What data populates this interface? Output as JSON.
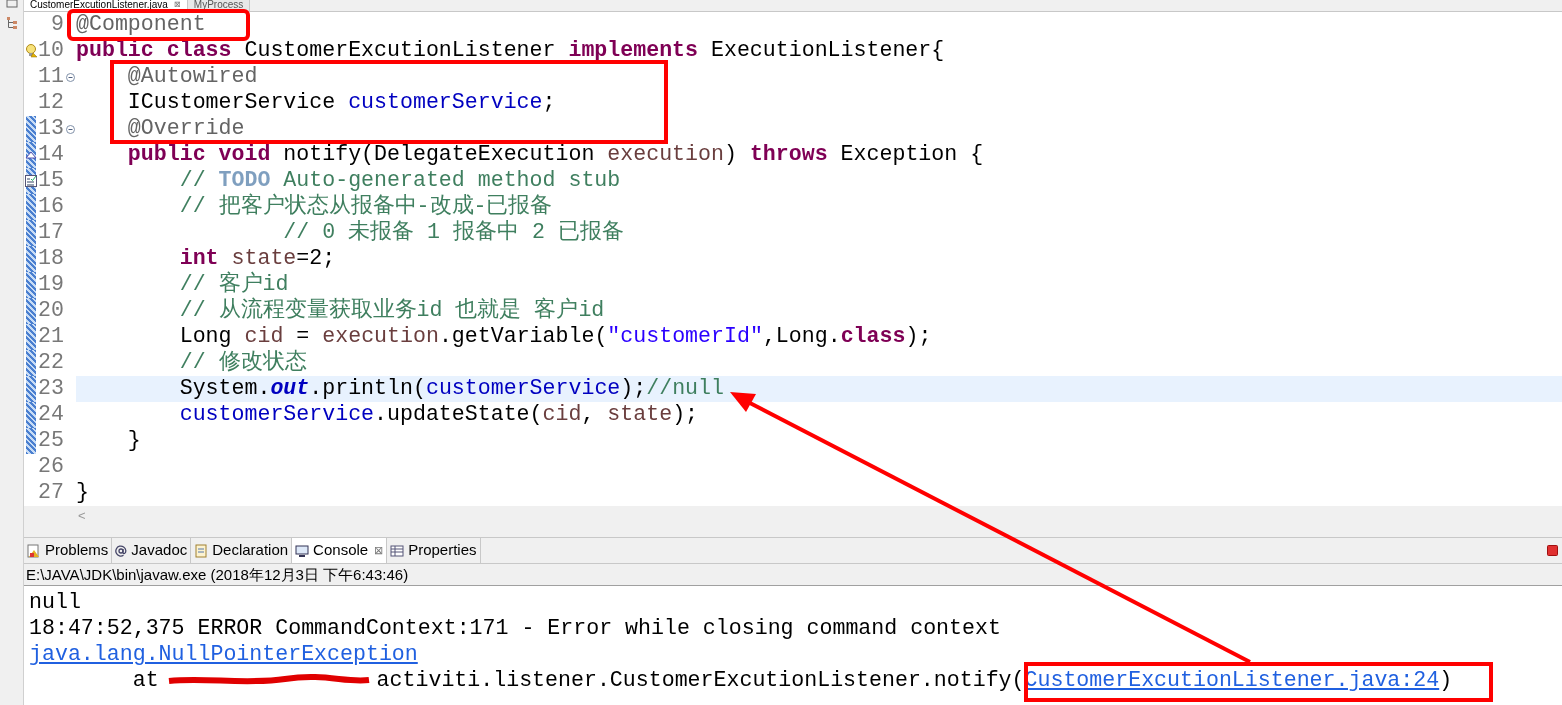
{
  "editor_tabs": [
    {
      "label": "CustomerExcutionListener.java",
      "selected": true,
      "close": "⊠"
    },
    {
      "label": "MyProcess",
      "selected": false
    }
  ],
  "code_lines": [
    {
      "number": "9",
      "kind": "none",
      "fold": false,
      "marked": false,
      "highlighted": false,
      "tokens": [
        {
          "text": "@Component",
          "kind": "annotation"
        }
      ]
    },
    {
      "number": "10",
      "kind": "warning",
      "fold": false,
      "marked": false,
      "highlighted": false,
      "tokens": [
        {
          "text": "public class ",
          "kind": "keyword"
        },
        {
          "text": "CustomerExcutionListener ",
          "kind": "plain"
        },
        {
          "text": "implements ",
          "kind": "keyword"
        },
        {
          "text": "ExecutionListener{",
          "kind": "plain"
        }
      ]
    },
    {
      "number": "11",
      "kind": "none",
      "fold": true,
      "marked": false,
      "highlighted": false,
      "tokens": [
        {
          "text": "    @Autowired",
          "kind": "annotation"
        }
      ]
    },
    {
      "number": "12",
      "kind": "none",
      "fold": false,
      "marked": false,
      "highlighted": false,
      "tokens": [
        {
          "text": "    ICustomerService ",
          "kind": "plain"
        },
        {
          "text": "customerService",
          "kind": "field"
        },
        {
          "text": ";",
          "kind": "plain"
        }
      ]
    },
    {
      "number": "13",
      "kind": "none",
      "fold": true,
      "marked": true,
      "highlighted": false,
      "tokens": [
        {
          "text": "    @Override",
          "kind": "annotation"
        }
      ]
    },
    {
      "number": "14",
      "kind": "override",
      "fold": false,
      "marked": true,
      "highlighted": false,
      "tokens": [
        {
          "text": "    public void ",
          "kind": "keyword"
        },
        {
          "text": "notify(DelegateExecution ",
          "kind": "plain"
        },
        {
          "text": "execution",
          "kind": "local"
        },
        {
          "text": ") ",
          "kind": "plain"
        },
        {
          "text": "throws ",
          "kind": "keyword"
        },
        {
          "text": "Exception {",
          "kind": "plain"
        }
      ]
    },
    {
      "number": "15",
      "kind": "task",
      "fold": false,
      "marked": true,
      "highlighted": false,
      "tokens": [
        {
          "text": "        // ",
          "kind": "comment"
        },
        {
          "text": "TODO ",
          "kind": "todo"
        },
        {
          "text": "Auto-generated method stub",
          "kind": "comment"
        }
      ]
    },
    {
      "number": "16",
      "kind": "none",
      "fold": false,
      "marked": true,
      "highlighted": false,
      "tokens": [
        {
          "text": "        // 把客户状态从报备中-改成-已报备",
          "kind": "comment"
        }
      ]
    },
    {
      "number": "17",
      "kind": "none",
      "fold": false,
      "marked": true,
      "highlighted": false,
      "tokens": [
        {
          "text": "                // 0 未报备 1 报备中 2 已报备",
          "kind": "comment"
        }
      ]
    },
    {
      "number": "18",
      "kind": "none",
      "fold": false,
      "marked": true,
      "highlighted": false,
      "tokens": [
        {
          "text": "        int ",
          "kind": "keyword"
        },
        {
          "text": "state",
          "kind": "local"
        },
        {
          "text": "=2;",
          "kind": "plain"
        }
      ]
    },
    {
      "number": "19",
      "kind": "none",
      "fold": false,
      "marked": true,
      "highlighted": false,
      "tokens": [
        {
          "text": "        // 客户id",
          "kind": "comment"
        }
      ]
    },
    {
      "number": "20",
      "kind": "none",
      "fold": false,
      "marked": true,
      "highlighted": false,
      "tokens": [
        {
          "text": "        // 从流程变量获取业务id 也就是 客户id",
          "kind": "comment"
        }
      ]
    },
    {
      "number": "21",
      "kind": "none",
      "fold": false,
      "marked": true,
      "highlighted": false,
      "tokens": [
        {
          "text": "        Long ",
          "kind": "plain"
        },
        {
          "text": "cid",
          "kind": "local"
        },
        {
          "text": " = ",
          "kind": "plain"
        },
        {
          "text": "execution",
          "kind": "local"
        },
        {
          "text": ".getVariable(",
          "kind": "plain"
        },
        {
          "text": "\"customerId\"",
          "kind": "string"
        },
        {
          "text": ",Long.",
          "kind": "plain"
        },
        {
          "text": "class",
          "kind": "keyword"
        },
        {
          "text": ");",
          "kind": "plain"
        }
      ]
    },
    {
      "number": "22",
      "kind": "none",
      "fold": false,
      "marked": true,
      "highlighted": false,
      "tokens": [
        {
          "text": "        // 修改状态",
          "kind": "comment"
        }
      ]
    },
    {
      "number": "23",
      "kind": "none",
      "fold": false,
      "marked": true,
      "highlighted": true,
      "tokens": [
        {
          "text": "        System.",
          "kind": "plain"
        },
        {
          "text": "out",
          "kind": "static"
        },
        {
          "text": ".println(",
          "kind": "plain"
        },
        {
          "text": "customerService",
          "kind": "field"
        },
        {
          "text": ");",
          "kind": "plain"
        },
        {
          "text": "//null",
          "kind": "comment"
        }
      ]
    },
    {
      "number": "24",
      "kind": "none",
      "fold": false,
      "marked": true,
      "highlighted": false,
      "tokens": [
        {
          "text": "        customerService",
          "kind": "field"
        },
        {
          "text": ".updateState(",
          "kind": "plain"
        },
        {
          "text": "cid",
          "kind": "local"
        },
        {
          "text": ", ",
          "kind": "plain"
        },
        {
          "text": "state",
          "kind": "local"
        },
        {
          "text": ");",
          "kind": "plain"
        }
      ]
    },
    {
      "number": "25",
      "kind": "none",
      "fold": false,
      "marked": true,
      "highlighted": false,
      "tokens": [
        {
          "text": "    }",
          "kind": "plain"
        }
      ]
    },
    {
      "number": "26",
      "kind": "none",
      "fold": false,
      "marked": false,
      "highlighted": false
    },
    {
      "number": "27",
      "kind": "none",
      "fold": false,
      "marked": false,
      "highlighted": false,
      "tokens": [
        {
          "text": "}",
          "kind": "plain"
        }
      ]
    }
  ],
  "scrollbar": {
    "arrow": "<"
  },
  "console_tabs": [
    {
      "label": "Problems",
      "selected": false
    },
    {
      "label": "Javadoc",
      "selected": false
    },
    {
      "label": "Declaration",
      "selected": false
    },
    {
      "label": "Console",
      "selected": true,
      "close": "⊠"
    },
    {
      "label": "Properties",
      "selected": false
    }
  ],
  "console": {
    "process": "E:\\JAVA\\JDK\\bin\\javaw.exe (2018年12月3日 下午6:43:46)",
    "lines": [
      {
        "kind": "text",
        "text": "null"
      },
      {
        "kind": "text",
        "text": "18:47:52,375 ERROR CommandContext:171 - Error while closing command context"
      },
      {
        "kind": "link",
        "text": "java.lang.NullPointerException"
      },
      {
        "kind": "trace",
        "prefix": "        at",
        "text": "activiti.listener.CustomerExcutionListener.notify(",
        "link": "CustomerExcutionListener.java:24",
        "suffix": ")"
      }
    ]
  }
}
